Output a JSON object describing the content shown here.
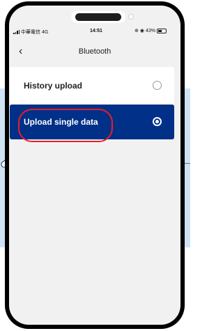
{
  "status_bar": {
    "carrier": "中華電信",
    "network": "4G",
    "time": "14:51",
    "battery": "43%"
  },
  "nav": {
    "back_icon": "chevron-left-icon",
    "title": "Bluetooth"
  },
  "options": [
    {
      "label": "History upload",
      "selected": false
    },
    {
      "label": "Upload single data",
      "selected": true
    }
  ],
  "colors": {
    "accent": "#003087",
    "highlight": "#e4202a",
    "background_band": "#cfe3f4"
  }
}
